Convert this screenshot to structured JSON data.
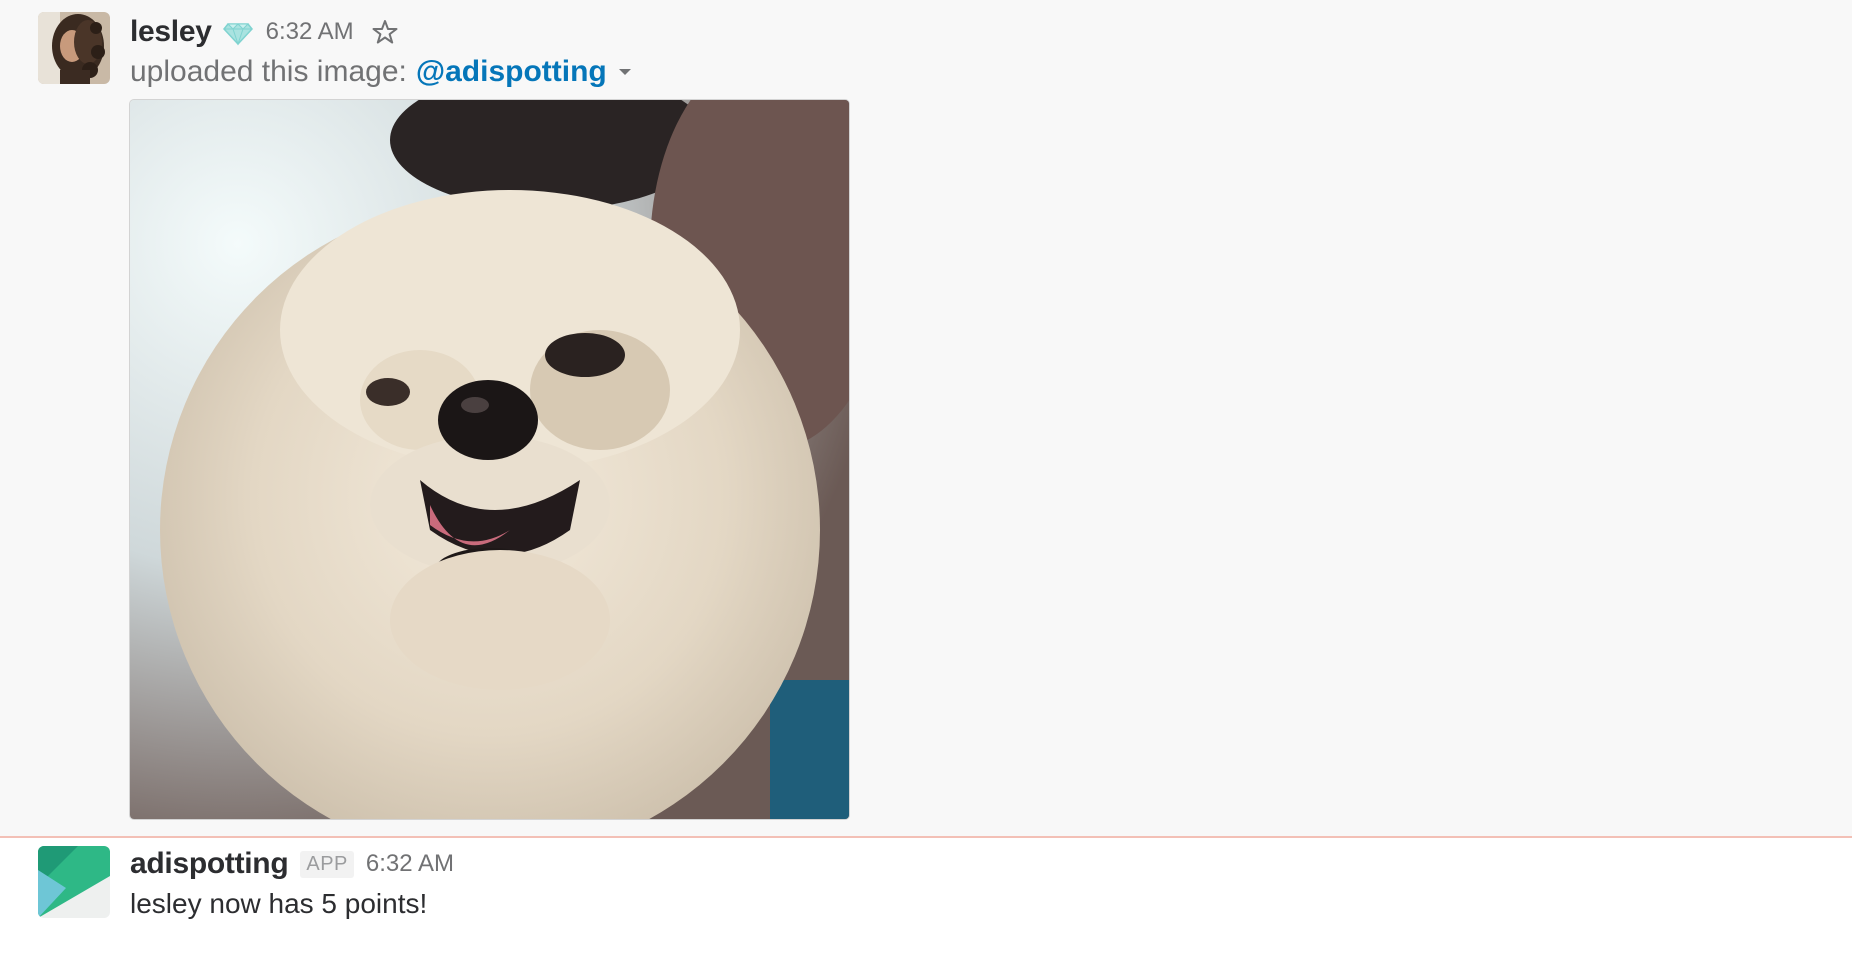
{
  "upload_message": {
    "author": "lesley",
    "author_badge_icon": "diamond-icon",
    "timestamp": "6:32 AM",
    "star_icon": "star-icon",
    "upload_text": "uploaded this image:",
    "channel": "@adispotting",
    "caret_icon": "caret-down-icon",
    "image_subject": "photo of a fluffy white dog"
  },
  "bot_message": {
    "author": "adispotting",
    "app_label": "APP",
    "timestamp": "6:32 AM",
    "text": "lesley now has 5 points!"
  },
  "colors": {
    "link": "#0576b9",
    "divider": "#f3c0b6",
    "badge": "#7fd3d0",
    "bot_green": "#2eb886",
    "bot_blue": "#6ec6d6"
  }
}
